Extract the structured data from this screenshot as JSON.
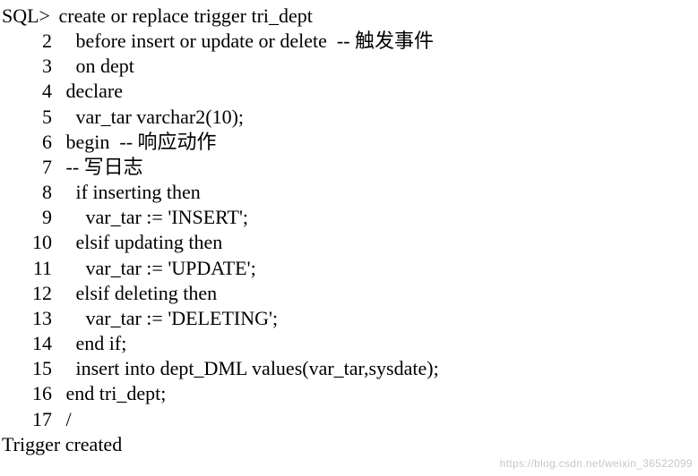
{
  "prompt": "SQL>",
  "lines": [
    {
      "n": "",
      "prompt": true,
      "text": " create or replace trigger tri_dept"
    },
    {
      "n": "2",
      "text": "   before insert or update or delete  -- 触发事件"
    },
    {
      "n": "3",
      "text": "   on dept"
    },
    {
      "n": "4",
      "text": " declare"
    },
    {
      "n": "5",
      "text": "   var_tar varchar2(10);"
    },
    {
      "n": "6",
      "text": " begin  -- 响应动作"
    },
    {
      "n": "7",
      "text": " -- 写日志"
    },
    {
      "n": "8",
      "text": "   if inserting then"
    },
    {
      "n": "9",
      "text": "     var_tar := 'INSERT';"
    },
    {
      "n": "10",
      "text": "   elsif updating then"
    },
    {
      "n": "11",
      "text": "     var_tar := 'UPDATE';"
    },
    {
      "n": "12",
      "text": "   elsif deleting then"
    },
    {
      "n": "13",
      "text": "     var_tar := 'DELETING';"
    },
    {
      "n": "14",
      "text": "   end if;"
    },
    {
      "n": "15",
      "text": "   insert into dept_DML values(var_tar,sysdate);"
    },
    {
      "n": "16",
      "text": " end tri_dept;"
    },
    {
      "n": "17",
      "text": " /"
    }
  ],
  "status": "Trigger created",
  "watermark": "https://blog.csdn.net/weixin_36522099"
}
